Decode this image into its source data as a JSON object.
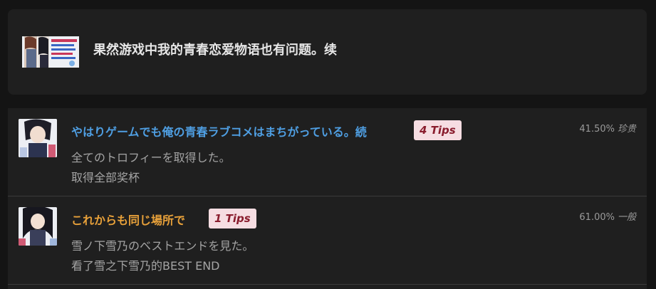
{
  "game": {
    "title": "果然游戏中我的青春恋爱物语也有问题。续",
    "cover_icon": "game-cover-art"
  },
  "trophies": [
    {
      "name": "やはりゲームでも俺の青春ラブコメはまちがっている。続",
      "tips": "4 Tips",
      "percent": "41.50%",
      "grade": "珍贵",
      "desc_ja": "全てのトロフィーを取得した。",
      "desc_zh": "取得全部奖杯",
      "name_color": "#4f9fe3",
      "thumb_icon": "trophy-thumbnail"
    },
    {
      "name": "これからも同じ場所で",
      "tips": "1 Tips",
      "percent": "61.00%",
      "grade": "一般",
      "desc_ja": "雪ノ下雪乃のベストエンドを見た。",
      "desc_zh": "看了雪之下雪乃的BEST END",
      "name_color": "#e8a13a",
      "thumb_icon": "trophy-thumbnail"
    }
  ]
}
